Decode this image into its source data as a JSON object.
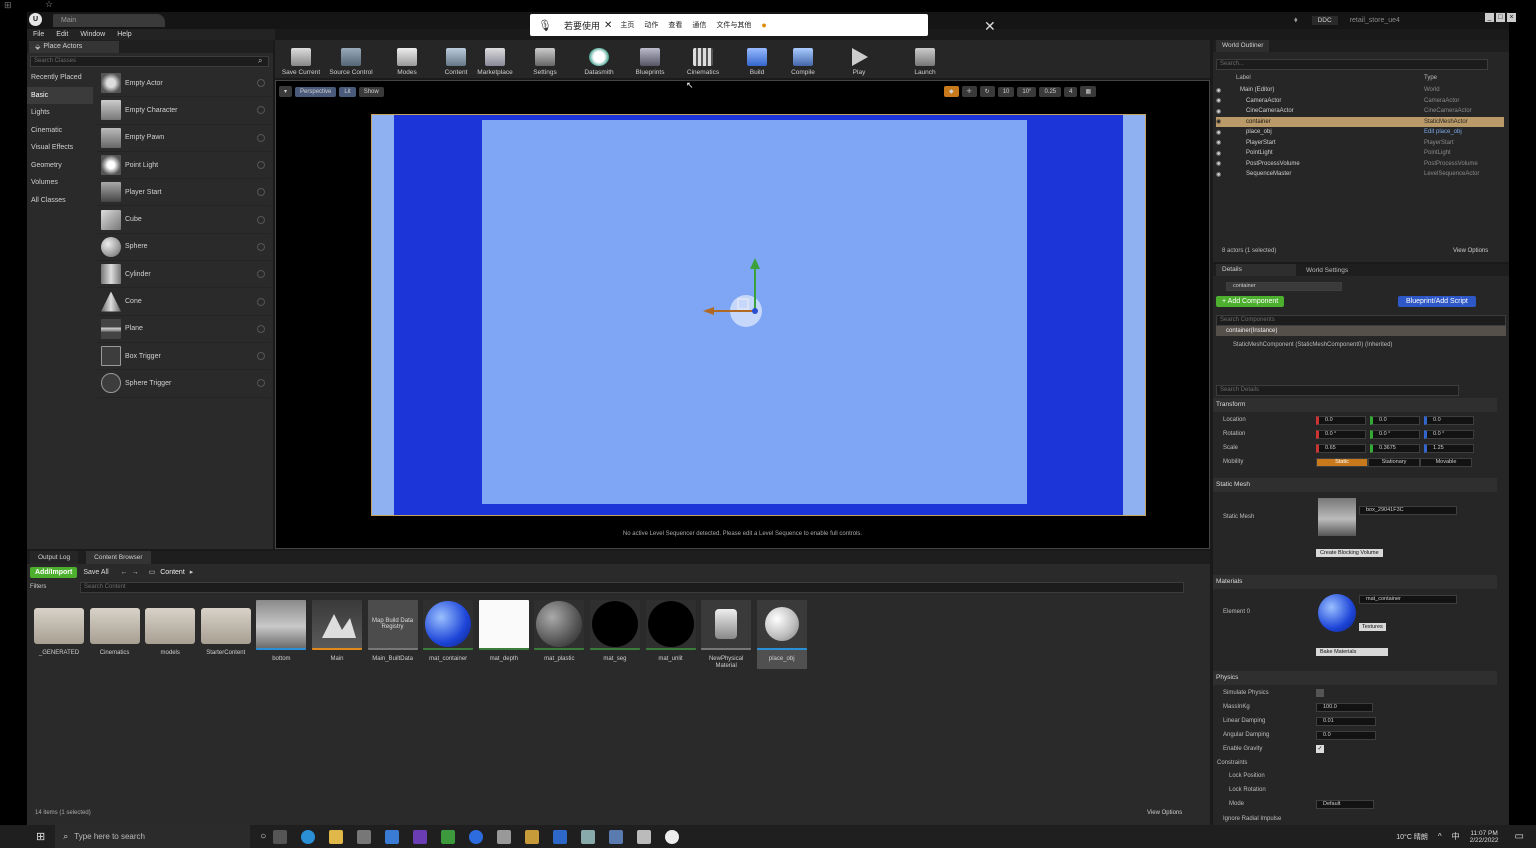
{
  "window": {
    "tab_title": "Main",
    "project_name": "retail_store_ue4",
    "ddc_label": "DDC"
  },
  "menu": [
    "File",
    "Edit",
    "Window",
    "Help"
  ],
  "place_actors": {
    "tab_label": "Place Actors",
    "search_placeholder": "Search Classes",
    "categories": [
      "Recently Placed",
      "Basic",
      "Lights",
      "Cinematic",
      "Visual Effects",
      "Geometry",
      "Volumes",
      "All Classes"
    ],
    "active_category": "Basic",
    "items": [
      "Empty Actor",
      "Empty Character",
      "Empty Pawn",
      "Point Light",
      "Player Start",
      "Cube",
      "Sphere",
      "Cylinder",
      "Cone",
      "Plane",
      "Box Trigger",
      "Sphere Trigger"
    ]
  },
  "toolbar": {
    "buttons": [
      "Save Current",
      "Source Control",
      "Modes",
      "Content",
      "Marketplace",
      "Settings",
      "Datasmith",
      "Blueprints",
      "Cinematics",
      "Build",
      "Compile",
      "Play",
      "Launch"
    ]
  },
  "ime_bar": {
    "prompt": "若要使用",
    "items": [
      "主页",
      "动作",
      "查看",
      "通信",
      "文件与其他"
    ]
  },
  "viewport": {
    "perspective": "Perspective",
    "lit": "Lit",
    "show": "Show",
    "snap_values": [
      "10",
      "10°",
      "0.25",
      "4"
    ],
    "message": "No active Level Sequencer detected. Please edit a Level Sequence to enable full controls."
  },
  "world_outliner": {
    "tab_label": "World Outliner",
    "search_placeholder": "Search...",
    "col_label": "Label",
    "col_type": "Type",
    "rows": [
      {
        "label": "Main (Editor)",
        "type": "World"
      },
      {
        "label": "CameraActor",
        "type": "CameraActor"
      },
      {
        "label": "CineCameraActor",
        "type": "CineCameraActor"
      },
      {
        "label": "container",
        "type": "StaticMeshActor"
      },
      {
        "label": "place_obj",
        "type": "Edit place_obj"
      },
      {
        "label": "PlayerStart",
        "type": "PlayerStart"
      },
      {
        "label": "PointLight",
        "type": "PointLight"
      },
      {
        "label": "PostProcessVolume",
        "type": "PostProcessVolume"
      },
      {
        "label": "SequenceMaster",
        "type": "LevelSequenceActor"
      }
    ],
    "selected": "container",
    "status": "8 actors (1 selected)",
    "view_options": "View Options"
  },
  "details": {
    "tab_details": "Details",
    "tab_world_settings": "World Settings",
    "name_value": "container",
    "add_component": "+ Add Component",
    "blueprint_button": "Blueprint/Add Script",
    "search_components": "Search Components",
    "instance_label": "container(Instance)",
    "component_label": "StaticMeshComponent (StaticMeshComponent0) (Inherited)",
    "search_details": "Search Details",
    "transform_header": "Transform",
    "location_label": "Location",
    "rotation_label": "Rotation",
    "scale_label": "Scale",
    "mobility_label": "Mobility",
    "location": [
      "0.0",
      "0.0",
      "0.0"
    ],
    "rotation": [
      "0.0 °",
      "0.0 °",
      "0.0 °"
    ],
    "scale": [
      "0.65",
      "0.3675",
      "1.25"
    ],
    "mobility": [
      "Static",
      "Stationary",
      "Movable"
    ],
    "static_mesh_header": "Static Mesh",
    "static_mesh_label": "Static Mesh",
    "static_mesh_value": "box_29041F3C",
    "create_blocking": "Create Blocking Volume",
    "materials_header": "Materials",
    "element_label": "Element 0",
    "material_value": "mat_container",
    "textures": "Textures",
    "bake_materials": "Bake Materials",
    "physics_header": "Physics",
    "simulate_physics": "Simulate Physics",
    "mass_label": "MassInKg",
    "mass_value": "100.0",
    "linear_damping": "Linear Damping",
    "linear_damping_value": "0.01",
    "angular_damping": "Angular Damping",
    "angular_damping_value": "0.0",
    "enable_gravity": "Enable Gravity",
    "constraints": "Constraints",
    "lock_position": "Lock Position",
    "lock_rotation": "Lock Rotation",
    "mode_label": "Mode",
    "mode_value": "Default",
    "ignore_radial": "Ignore Radial Impulse"
  },
  "bottom_tabs": [
    "Output Log",
    "Content Browser"
  ],
  "content_browser": {
    "add_import": "Add/Import",
    "save_all": "Save All",
    "path": "Content",
    "filters": "Filters",
    "search_placeholder": "Search Content",
    "status": "14 items (1 selected)",
    "view_options": "View Options",
    "assets": [
      {
        "name": "_GENERATED",
        "kind": "folder"
      },
      {
        "name": "Cinematics",
        "kind": "folder"
      },
      {
        "name": "models",
        "kind": "folder"
      },
      {
        "name": "StarterContent",
        "kind": "folder"
      },
      {
        "name": "bottom",
        "kind": "mesh"
      },
      {
        "name": "Main",
        "kind": "level"
      },
      {
        "name": "Main_BuiltData",
        "kind": "data"
      },
      {
        "name": "mat_container",
        "kind": "mat-blue"
      },
      {
        "name": "mat_depth",
        "kind": "mat-white"
      },
      {
        "name": "mat_plastic",
        "kind": "mat-grey"
      },
      {
        "name": "mat_seg",
        "kind": "mat-black"
      },
      {
        "name": "mat_unlit",
        "kind": "mat-black"
      },
      {
        "name": "NewPhysical Material",
        "kind": "physmat"
      },
      {
        "name": "place_obj",
        "kind": "mesh-white"
      }
    ],
    "data_thumb_text": "Map Build Data Registry"
  },
  "taskbar": {
    "search_placeholder": "Type here to search",
    "weather": "10°C 晴朗",
    "ime": "中",
    "time": "11:07 PM",
    "date": "2/22/2022"
  },
  "colors": {
    "accent_green": "#4caf2e",
    "accent_blue": "#2e58c8",
    "scene_blue": "#1b35d8",
    "scene_light": "#7ea6f4",
    "selected_row": "#bb9a6a"
  }
}
